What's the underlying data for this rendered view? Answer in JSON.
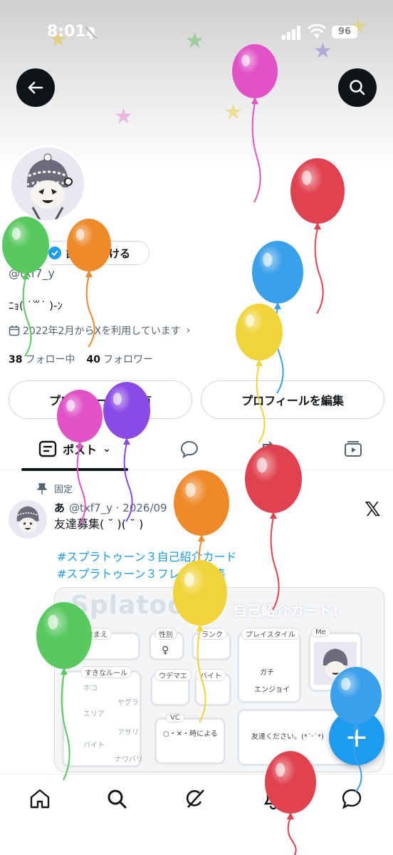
{
  "status_bar": {
    "time": "8:01",
    "battery": "96"
  },
  "profile": {
    "verify_label": "認証を受ける",
    "handle": "@txf7_y",
    "bio": "ﾆｮ( ˙꒳˙ )-ﾝ",
    "joined": "2022年2月からXを利用しています",
    "following_count": "38",
    "following_label": "フォロー中",
    "followers_count": "40",
    "followers_label": "フォロワー",
    "share_button": "プロフィールを共有",
    "edit_button": "プロフィールを編集"
  },
  "tabs": {
    "posts_label": "ポスト"
  },
  "post": {
    "pinned_label": "固定",
    "display_name": "あ",
    "handle_date": "@txf7_y · 2026/09",
    "text": "友達募集( ˘ )( ˘ )",
    "hashtag_1": "#スプラトゥーン３自己紹介カード",
    "hashtag_2": "#スプラトゥーン３フレンド募集",
    "card": {
      "title": "Splatoon3",
      "subtitle": "自己紹介カード!",
      "label_name": "なまえ",
      "label_gender": "性別",
      "label_rank": "ランク",
      "label_playstyle": "プレイスタイル",
      "label_me": "Me",
      "label_rules": "すきなルール",
      "label_udemae": "ウデマエ",
      "label_baito": "バイト",
      "label_vc": "VC",
      "gender_symbol": "♀",
      "playstyle_1": "ガチ",
      "playstyle_2": "エンジョイ",
      "vc_text": "○・✕・時による",
      "message": "友達ください。(*ˊᵕˋ*)",
      "rule_1": "ホコ",
      "rule_2": "ヤグラ",
      "rule_3": "エリア",
      "rule_4": "アサリ",
      "rule_5": "バイト",
      "rule_6": "ナワバリ"
    }
  },
  "colors": {
    "accent": "#1d9bf0",
    "text_primary": "#0f1419",
    "text_secondary": "#536471",
    "balloon_pink": "#e052c6",
    "balloon_red": "#e0434f",
    "balloon_blue": "#3aa0ea",
    "balloon_yellow": "#f0d43a",
    "balloon_green": "#58c95e",
    "balloon_orange": "#ee8a2a",
    "balloon_purple": "#8a4ae6"
  }
}
